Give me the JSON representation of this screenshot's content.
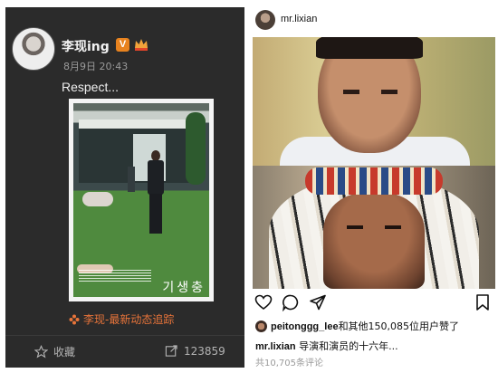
{
  "weibo": {
    "user_name": "李现ing",
    "verified_badge": "V",
    "crown_icon": "crown-icon",
    "timestamp": "8月9日 20:43",
    "post_text": "Respect...",
    "poster_title": "기생충",
    "link_text": "李现-最新动态追踪",
    "collect_label": "收藏",
    "repost_count": "123859",
    "colors": {
      "background": "#2b2b2b",
      "link": "#e8743a",
      "badge": "#e8831f"
    }
  },
  "instagram": {
    "username": "mr.lixian",
    "liked_by_user": "peitonggg_lee",
    "likes_text": "和其他150,085位用户赞了",
    "caption_user": "mr.lixian",
    "caption_text": " 导演和演员的十六年...",
    "comments_text": "共10,705条评论",
    "icons": [
      "heart-icon",
      "comment-icon",
      "share-icon",
      "bookmark-icon"
    ]
  }
}
